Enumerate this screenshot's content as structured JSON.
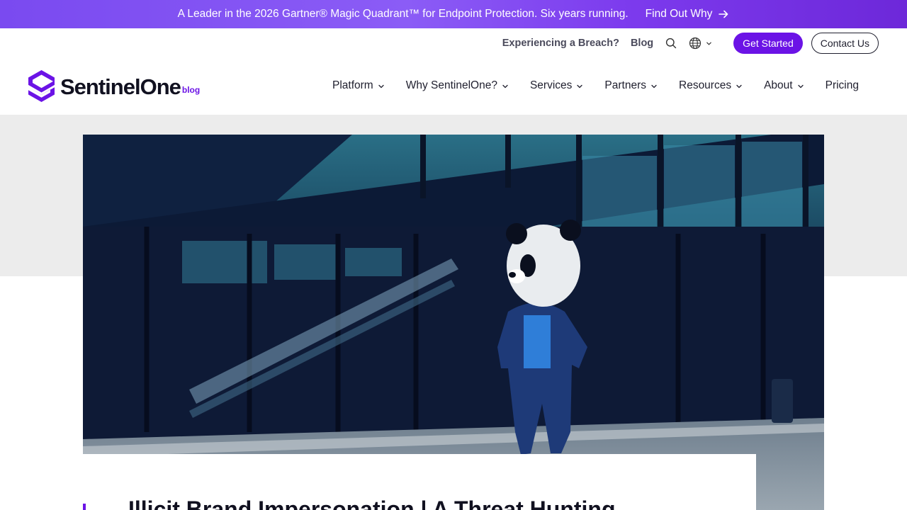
{
  "announcement": {
    "text": "A Leader in the 2026 Gartner® Magic Quadrant™ for Endpoint Protection. Six years running.",
    "link": "Find Out Why",
    "arrow_icon": "arrow-right-icon"
  },
  "utility": {
    "breach": "Experiencing a Breach?",
    "blog": "Blog",
    "search_icon": "search-icon",
    "globe_icon": "globe-icon",
    "get_started": "Get Started",
    "contact": "Contact Us"
  },
  "brand": {
    "name": "SentinelOne",
    "sub": "blog",
    "accent": "#6b13e6"
  },
  "nav": {
    "items": [
      {
        "label": "Platform",
        "dropdown": true
      },
      {
        "label": "Why SentinelOne?",
        "dropdown": true
      },
      {
        "label": "Services",
        "dropdown": true
      },
      {
        "label": "Partners",
        "dropdown": true
      },
      {
        "label": "Resources",
        "dropdown": true
      },
      {
        "label": "About",
        "dropdown": true
      },
      {
        "label": "Pricing",
        "dropdown": false
      }
    ]
  },
  "article": {
    "title": "Illicit Brand Impersonation | A Threat Hunting"
  }
}
